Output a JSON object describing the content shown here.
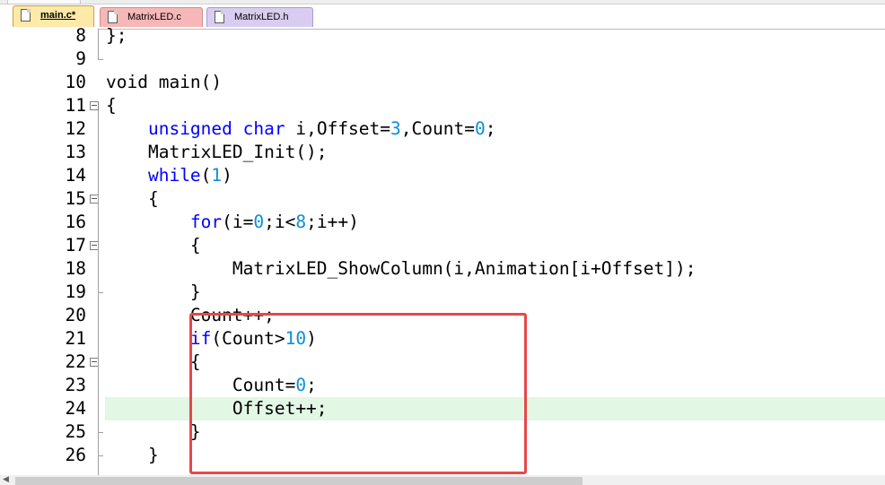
{
  "tabs": [
    {
      "label": "main.c*",
      "active": true
    },
    {
      "label": "MatrixLED.c",
      "active": false
    },
    {
      "label": "MatrixLED.h",
      "active": false
    }
  ],
  "colors": {
    "keyword": "#0000ff",
    "number": "#0a8fd8",
    "current_line": "#e2f7e4",
    "highlight_box": "#e8474a",
    "tab_main": "#fde9a8",
    "tab_c": "#f5b7b7",
    "tab_h": "#d8cdf0"
  },
  "editor": {
    "current_line": 24,
    "lines": [
      {
        "n": "8",
        "code": "};"
      },
      {
        "n": "9",
        "code": ""
      },
      {
        "n": "10",
        "code": "void main()"
      },
      {
        "n": "11",
        "code": "{"
      },
      {
        "n": "12",
        "code": "    unsigned char i,Offset=3,Count=0;"
      },
      {
        "n": "13",
        "code": "    MatrixLED_Init();"
      },
      {
        "n": "14",
        "code": "    while(1)"
      },
      {
        "n": "15",
        "code": "    {"
      },
      {
        "n": "16",
        "code": "        for(i=0;i<8;i++)"
      },
      {
        "n": "17",
        "code": "        {"
      },
      {
        "n": "18",
        "code": "            MatrixLED_ShowColumn(i,Animation[i+Offset]);"
      },
      {
        "n": "19",
        "code": "        }"
      },
      {
        "n": "20",
        "code": "        Count++;"
      },
      {
        "n": "21",
        "code": "        if(Count>10)"
      },
      {
        "n": "22",
        "code": "        {"
      },
      {
        "n": "23",
        "code": "            Count=0;"
      },
      {
        "n": "24",
        "code": "            Offset++;"
      },
      {
        "n": "25",
        "code": "        }"
      },
      {
        "n": "26",
        "code": "    }"
      }
    ]
  }
}
